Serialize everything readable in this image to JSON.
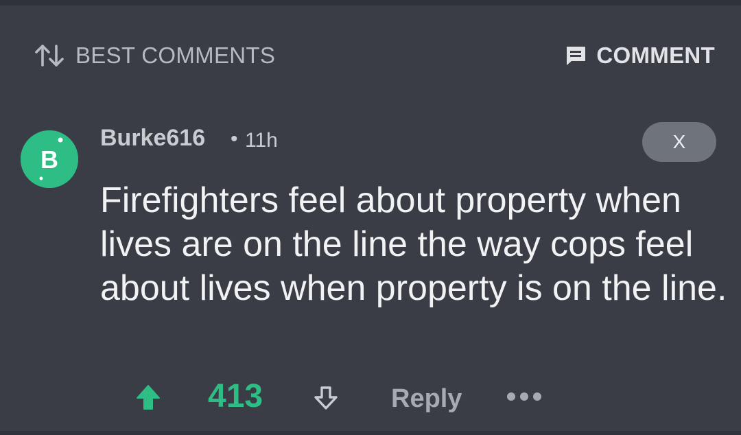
{
  "header": {
    "sort_label": "BEST COMMENTS",
    "sort_icon": "sort-arrows-icon",
    "comment_label": "COMMENT",
    "comment_icon": "comment-icon"
  },
  "comment": {
    "avatar_letter": "B",
    "username": "Burke616",
    "separator": "•",
    "timestamp": "11h",
    "close_label": "X",
    "body": "Firefighters feel about property when lives are on the line the way cops feel about lives when property is on the line.",
    "score": "413",
    "reply_label": "Reply",
    "upvote_icon": "upvote-arrow-icon",
    "downvote_icon": "downvote-arrow-icon",
    "more_icon": "more-dots-icon"
  },
  "colors": {
    "background": "#3a3d45",
    "accent_green": "#2dbd85",
    "close_pill": "#6f737b"
  }
}
